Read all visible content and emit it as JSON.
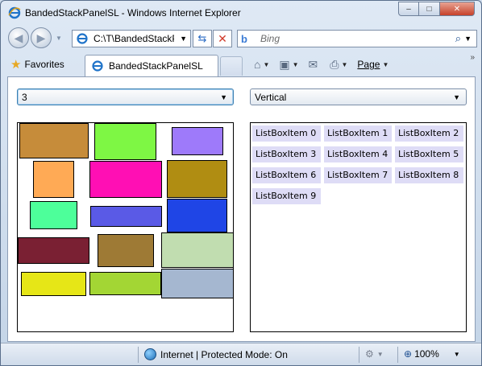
{
  "window": {
    "title": "BandedStackPanelSL - Windows Internet Explorer",
    "controls": {
      "minimize": "‒",
      "maximize": "□",
      "close": "✕"
    }
  },
  "address": {
    "url": "C:\\T\\BandedStackP"
  },
  "search": {
    "placeholder": "Bing"
  },
  "favorites": {
    "label": "Favorites"
  },
  "tab": {
    "label": "BandedStackPanelSL"
  },
  "commands": {
    "page": "Page"
  },
  "controls": {
    "band_count": "3",
    "orientation": "Vertical"
  },
  "left_panel": {
    "rectangles": [
      {
        "color": "#c68c3a"
      },
      {
        "color": "#7ef744"
      },
      {
        "color": "#9e7afa"
      },
      {
        "color": "#ffaa55"
      },
      {
        "color": "#ff0fb4"
      },
      {
        "color": "#b08d12"
      },
      {
        "color": "#4dff9a"
      },
      {
        "color": "#5a5ae6"
      },
      {
        "color": "#1f45e6"
      },
      {
        "color": "#7a2033"
      },
      {
        "color": "#9e7a35"
      },
      {
        "color": "#c1ddb0"
      },
      {
        "color": "#e6e617"
      },
      {
        "color": "#a3d634"
      },
      {
        "color": "#a5b7d0"
      }
    ]
  },
  "right_panel": {
    "items": [
      "ListBoxItem 0",
      "ListBoxItem 1",
      "ListBoxItem 2",
      "ListBoxItem 3",
      "ListBoxItem 4",
      "ListBoxItem 5",
      "ListBoxItem 6",
      "ListBoxItem 7",
      "ListBoxItem 8",
      "ListBoxItem 9"
    ],
    "item_color": "#dedcf6"
  },
  "status": {
    "zone": "Internet | Protected Mode: On",
    "zoom": "100%"
  }
}
